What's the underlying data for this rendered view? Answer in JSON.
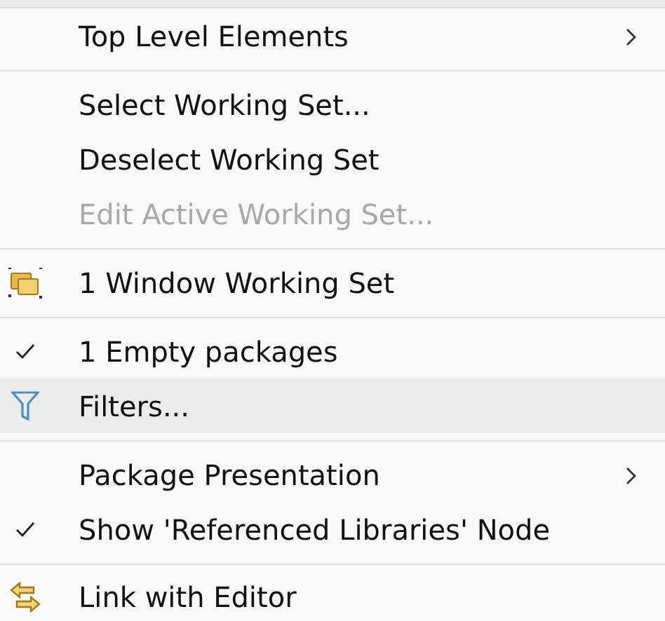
{
  "menu": {
    "items": [
      {
        "kind": "item",
        "label": "Top Level Elements",
        "checked": false,
        "disabled": false,
        "selected": false,
        "submenu": true
      },
      {
        "kind": "separator"
      },
      {
        "kind": "item",
        "label": "Select Working Set...",
        "checked": false,
        "disabled": false,
        "selected": false,
        "submenu": false
      },
      {
        "kind": "item",
        "label": "Deselect Working Set",
        "checked": false,
        "disabled": false,
        "selected": false,
        "submenu": false
      },
      {
        "kind": "item",
        "label": "Edit Active Working Set...",
        "checked": false,
        "disabled": true,
        "selected": false,
        "submenu": false
      },
      {
        "kind": "separator"
      },
      {
        "kind": "folders",
        "label": "1 Window Working Set",
        "checked": false,
        "disabled": false,
        "selected": false,
        "submenu": false
      },
      {
        "kind": "separator"
      },
      {
        "kind": "item",
        "label": "1 Empty packages",
        "checked": true,
        "disabled": false,
        "selected": false,
        "submenu": false
      },
      {
        "kind": "filter",
        "label": "Filters...",
        "checked": false,
        "disabled": false,
        "selected": true,
        "submenu": false
      },
      {
        "kind": "separator"
      },
      {
        "kind": "item",
        "label": "Package Presentation",
        "checked": false,
        "disabled": false,
        "selected": false,
        "submenu": true
      },
      {
        "kind": "item",
        "label": "Show 'Referenced Libraries' Node",
        "checked": true,
        "disabled": false,
        "selected": false,
        "submenu": false
      },
      {
        "kind": "separator"
      },
      {
        "kind": "link",
        "label": "Link with Editor",
        "checked": false,
        "disabled": false,
        "selected": false,
        "submenu": false
      }
    ]
  }
}
